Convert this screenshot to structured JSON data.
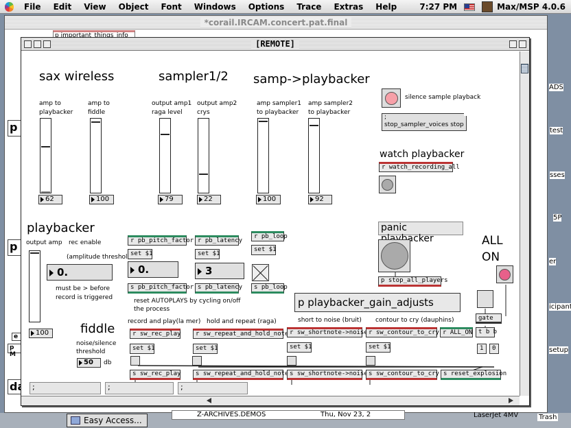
{
  "menubar": {
    "items": [
      "File",
      "Edit",
      "View",
      "Object",
      "Font",
      "Windows",
      "Options",
      "Trace",
      "Extras",
      "Help"
    ],
    "clock": "7:27 PM",
    "app_name": "Max/MSP 4.0.6"
  },
  "bg_window": {
    "title": "*corail.IRCAM.concert.pat.final",
    "top_object": "p important_things_info",
    "side_labels": [
      "ADS",
      "test",
      "sses",
      "5P",
      "er",
      "icipant",
      "setup"
    ],
    "left_stubs": [
      "p",
      "p",
      "p M",
      "da",
      "e"
    ]
  },
  "remote": {
    "title": "[REMOTE]",
    "sax": {
      "heading": "sax wireless",
      "amp_playbacker": "amp to\nplaybacker",
      "amp_fiddle": "amp to\nfiddle",
      "val1": "62",
      "val2": "100"
    },
    "sampler": {
      "heading": "sampler1/2",
      "out1": "output amp1\nraga level",
      "out2": "output amp2\ncrys",
      "val1": "79",
      "val2": "22"
    },
    "samp_pb": {
      "heading": "samp->playbacker",
      "l1": "amp sampler1\nto playbacker",
      "l2": "amp sampler2\nto playbacker",
      "val1": "100",
      "val2": "92"
    },
    "silence": {
      "label": "silence sample playback",
      "msg_line1": ";",
      "msg_line2": "stop_sampler_voices stop"
    },
    "watch": {
      "heading": "watch playbacker",
      "recv": "r watch_recording_all"
    },
    "panic": {
      "heading": "panic playbacker",
      "send": "p stop_all_players"
    },
    "all_on": {
      "line1": "ALL",
      "line2": "ON"
    },
    "playbacker": {
      "heading": "playbacker",
      "output_amp": "output amp",
      "rec_enable": "rec enable",
      "threshold": "(amplitude threshold)",
      "threshold_val": "0.",
      "note": "must be > before\nrecord is triggered",
      "val": "100"
    },
    "pitch": {
      "recv": "r pb_pitch_factor",
      "set": "set $1",
      "val": "0.",
      "send": "s pb_pitch_factor"
    },
    "latency": {
      "recv": "r pb_latency",
      "set": "set $1",
      "val": "3",
      "send": "s pb_latency"
    },
    "loop": {
      "recv": "r pb_loop",
      "set": "set $1",
      "send": "s pb_loop"
    },
    "reset_note": "reset AUTOPLAYS by cycling on/off\nthe process",
    "gain_adjusts": "p playbacker_gain_adjusts",
    "fiddle": {
      "heading": "fiddle",
      "label": "noise/silence\nthreshold",
      "val": "50",
      "unit": "db"
    },
    "modes": {
      "rec_play_label": "record and play(la mer)",
      "hold_repeat_label": "hold and repeat (raga)",
      "short_noise_label": "short to noise (bruit)",
      "contour_label": "contour to cry (dauphins)",
      "r_rec_play": "r sw_rec_play",
      "r_repeat": "r sw_repeat_and_hold_note",
      "r_shortnote": "r sw_shortnote->noise",
      "r_contour": "r sw_contour_to_cry",
      "r_all_on": "r ALL_ON",
      "set1": "set $1",
      "set2": "set $1",
      "set3": "set $1",
      "set4": "set $1",
      "s_rec_play": "s sw_rec_play",
      "s_repeat": "s sw_repeat_and_hold_note",
      "s_shortnote": "s sw_shortnote->noise",
      "s_contour": "s sw_contour_to_cry",
      "s_reset": "s reset_explosion",
      "gate": "gate",
      "tbb": "t b b",
      "one": "1",
      "zero": "0"
    },
    "bottom_boxes": [
      ";",
      ";",
      ";"
    ]
  },
  "taskbar": {
    "easy_access": "Easy Access...",
    "archives": "Z-ARCHIVES.DEMOS",
    "archives_date": "Thu, Nov 23, 2",
    "laserjet": "LaserJet 4MV",
    "trash": "Trash"
  }
}
